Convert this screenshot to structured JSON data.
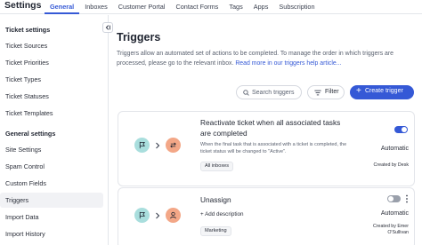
{
  "app": {
    "title": "Settings"
  },
  "tabs": [
    {
      "label": "General",
      "active": true
    },
    {
      "label": "Inboxes",
      "active": false
    },
    {
      "label": "Customer Portal",
      "active": false
    },
    {
      "label": "Contact Forms",
      "active": false
    },
    {
      "label": "Tags",
      "active": false
    },
    {
      "label": "Apps",
      "active": false
    },
    {
      "label": "Subscription",
      "active": false
    }
  ],
  "sidebar": {
    "sections": [
      {
        "title": "Ticket settings",
        "items": [
          "Ticket Sources",
          "Ticket Priorities",
          "Ticket Types",
          "Ticket Statuses",
          "Ticket Templates"
        ]
      },
      {
        "title": "General settings",
        "items": [
          "Site Settings",
          "Spam Control",
          "Custom Fields",
          "Triggers",
          "Import Data",
          "Import History"
        ]
      }
    ],
    "active_item": "Triggers"
  },
  "main": {
    "title": "Triggers",
    "description": "Triggers allow an automated set of actions to be completed. To manage the order in which triggers are processed, please go to the relevant inbox.",
    "help_link": "Read more in our triggers help article...",
    "search_placeholder": "Search triggers",
    "filter_label": "Filter",
    "create_label": "Create trigger",
    "create_icon": "+"
  },
  "triggers": [
    {
      "title": "Reactivate ticket when all associated tasks are completed",
      "description": "When the final task that is associated with a ticket is completed, the ticket status will be changed to \"Active\".",
      "tag": "All inboxes",
      "mode": "Automatic",
      "created_by": "Created by Desk",
      "enabled": true,
      "trigger_icon": "flag-icon",
      "action_icon": "status-change-icon"
    },
    {
      "title": "Unassign",
      "add_description": "+ Add description",
      "tag": "Marketing",
      "mode": "Automatic",
      "created_by": "Created by Emer O'Sullivan",
      "enabled": false,
      "trigger_icon": "flag-icon",
      "action_icon": "person-icon"
    }
  ],
  "colors": {
    "accent": "#3559d6",
    "teal_badge": "#a9dedd",
    "orange_badge": "#f3a787"
  }
}
